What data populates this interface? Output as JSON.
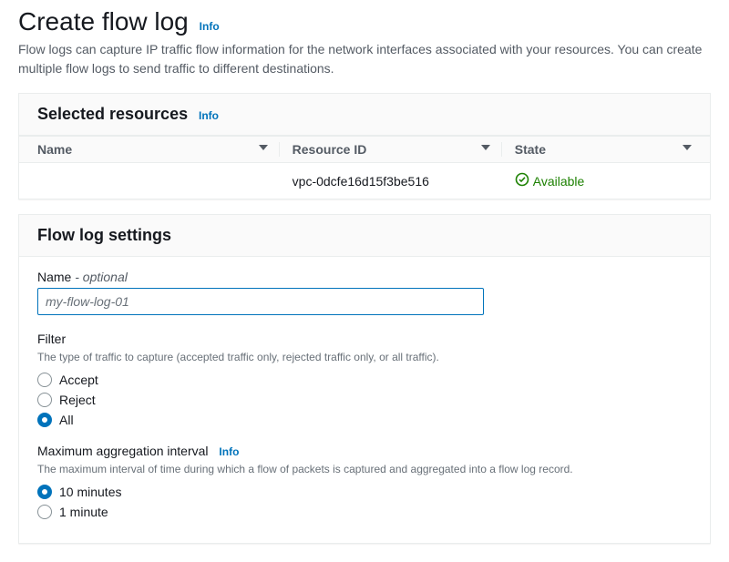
{
  "header": {
    "title": "Create flow log",
    "info": "Info",
    "description": "Flow logs can capture IP traffic flow information for the network interfaces associated with your resources. You can create multiple flow logs to send traffic to different destinations."
  },
  "selected": {
    "title": "Selected resources",
    "info": "Info",
    "columns": {
      "name": "Name",
      "resource_id": "Resource ID",
      "state": "State"
    },
    "rows": [
      {
        "name": "",
        "resource_id": "vpc-0dcfe16d15f3be516",
        "state": "Available"
      }
    ]
  },
  "settings": {
    "title": "Flow log settings",
    "name": {
      "label": "Name",
      "optional": "- optional",
      "placeholder": "my-flow-log-01",
      "value": ""
    },
    "filter": {
      "label": "Filter",
      "help": "The type of traffic to capture (accepted traffic only, rejected traffic only, or all traffic).",
      "options": {
        "accept": "Accept",
        "reject": "Reject",
        "all": "All"
      },
      "selected": "all"
    },
    "agg": {
      "label": "Maximum aggregation interval",
      "info": "Info",
      "help": "The maximum interval of time during which a flow of packets is captured and aggregated into a flow log record.",
      "options": {
        "ten": "10 minutes",
        "one": "1 minute"
      },
      "selected": "ten"
    }
  }
}
